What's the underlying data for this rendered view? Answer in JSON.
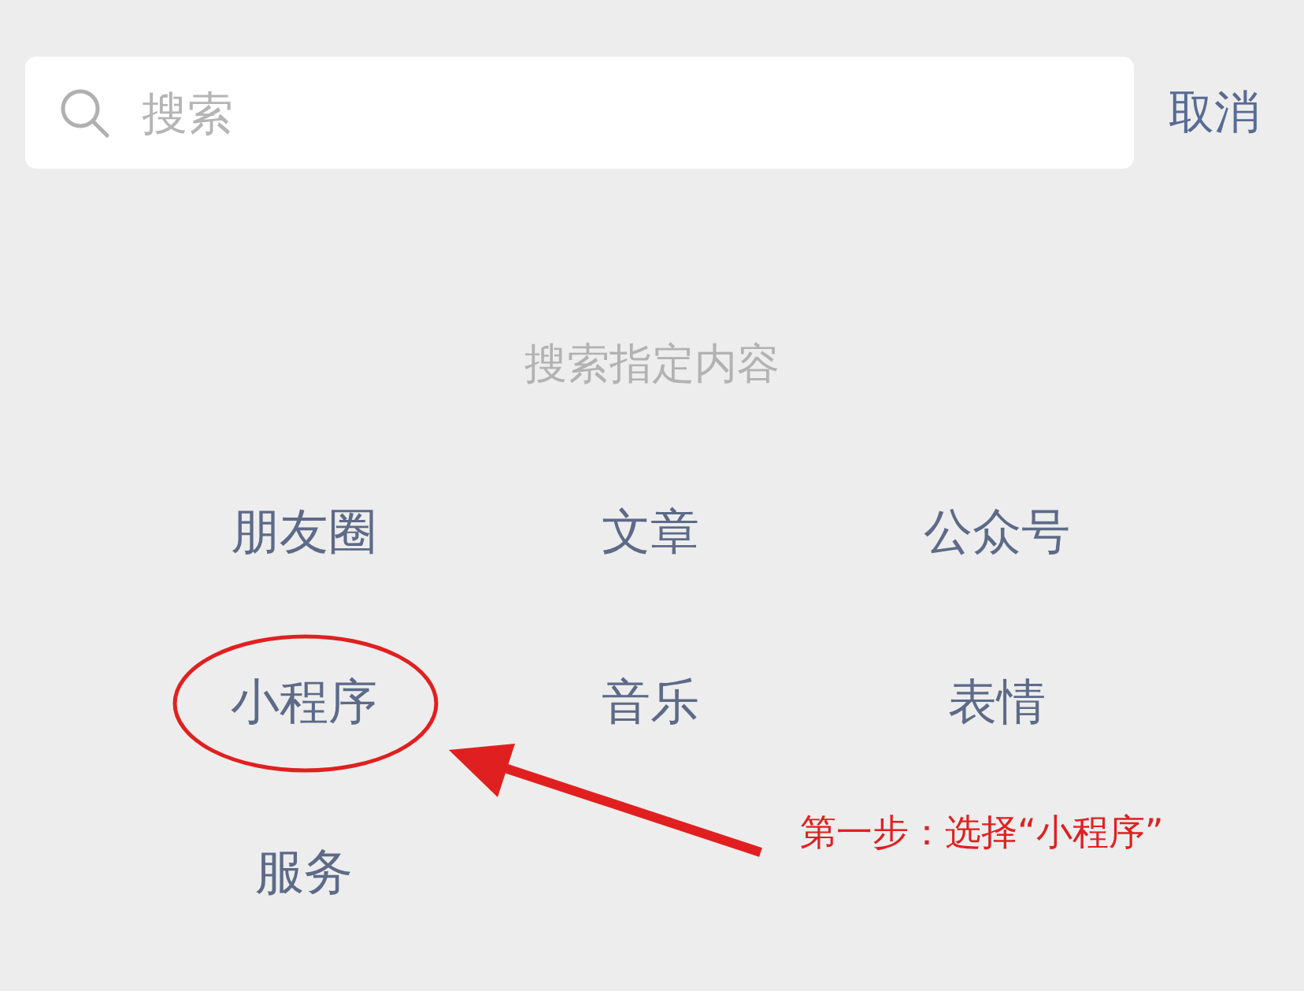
{
  "search": {
    "placeholder": "搜索",
    "cancel": "取消"
  },
  "section_title": "搜索指定内容",
  "options": [
    {
      "label": "朋友圈",
      "circled": false
    },
    {
      "label": "文章",
      "circled": false
    },
    {
      "label": "公众号",
      "circled": false
    },
    {
      "label": "小程序",
      "circled": true
    },
    {
      "label": "音乐",
      "circled": false
    },
    {
      "label": "表情",
      "circled": false
    },
    {
      "label": "服务",
      "circled": false
    }
  ],
  "annotation": {
    "text": "第一步：选择“小程序”"
  }
}
